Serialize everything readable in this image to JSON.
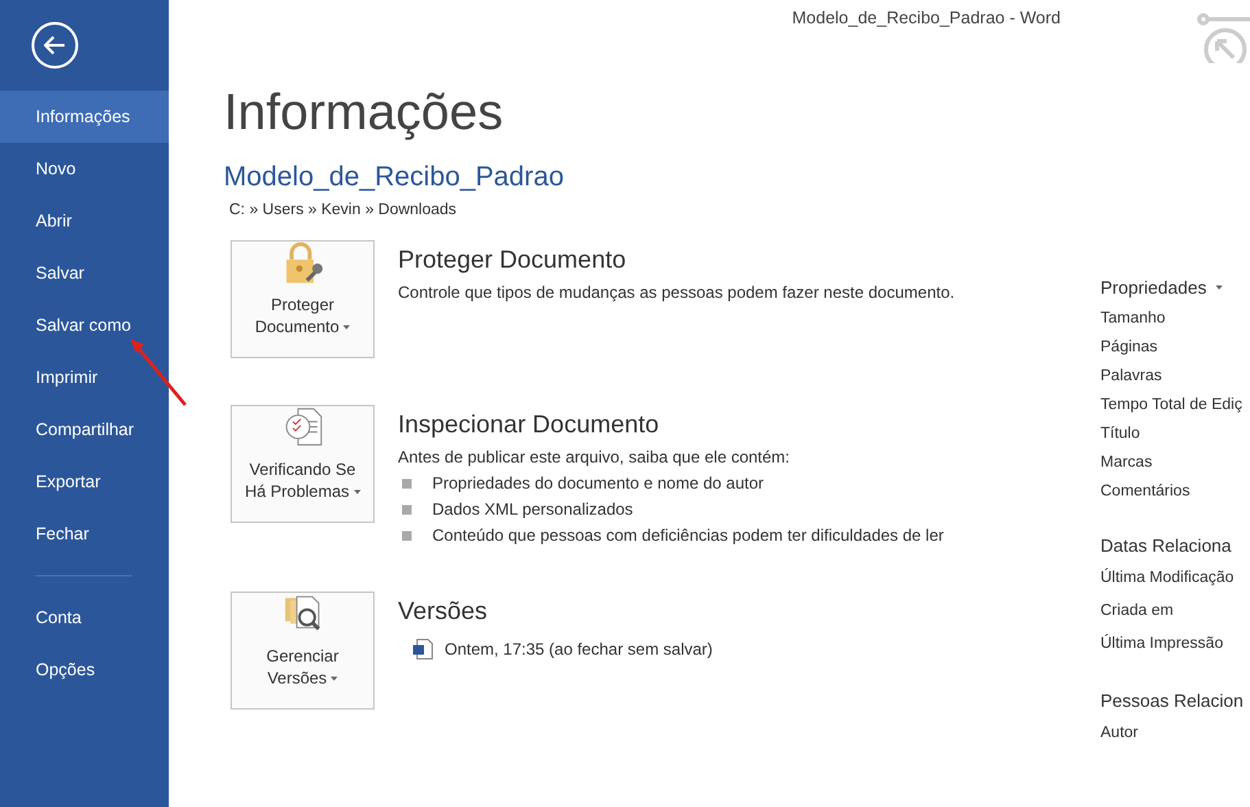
{
  "window": {
    "title": "Modelo_de_Recibo_Padrao - Word"
  },
  "nav": {
    "main": [
      {
        "label": "Informações",
        "selected": true
      },
      {
        "label": "Novo",
        "selected": false
      },
      {
        "label": "Abrir",
        "selected": false
      },
      {
        "label": "Salvar",
        "selected": false
      },
      {
        "label": "Salvar como",
        "selected": false
      },
      {
        "label": "Imprimir",
        "selected": false
      },
      {
        "label": "Compartilhar",
        "selected": false
      },
      {
        "label": "Exportar",
        "selected": false
      },
      {
        "label": "Fechar",
        "selected": false
      }
    ],
    "secondary": [
      {
        "label": "Conta",
        "selected": false
      },
      {
        "label": "Opções",
        "selected": false
      }
    ]
  },
  "page": {
    "heading": "Informações",
    "doc_name": "Modelo_de_Recibo_Padrao",
    "path": "C: » Users » Kevin » Downloads"
  },
  "sections": [
    {
      "kind": "protect",
      "button": [
        "Proteger",
        "Documento"
      ],
      "title": "Proteger Documento",
      "text": "Controle que tipos de mudanças as pessoas podem fazer neste documento."
    },
    {
      "kind": "inspect",
      "button": [
        "Verificando Se",
        "Há Problemas"
      ],
      "title": "Inspecionar Documento",
      "text": "Antes de publicar este arquivo, saiba que ele contém:",
      "bullets": [
        "Propriedades do documento e nome do autor",
        "Dados XML personalizados",
        "Conteúdo que pessoas com deficiências podem ter dificuldades de ler"
      ]
    },
    {
      "kind": "versions",
      "button": [
        "Gerenciar",
        "Versões"
      ],
      "title": "Versões",
      "version": "Ontem, 17:35 (ao fechar sem salvar)"
    }
  ],
  "properties": {
    "groups": [
      {
        "title": "Propriedades",
        "dropdown": true,
        "items": [
          "Tamanho",
          "Páginas",
          "Palavras",
          "Tempo Total de Ediç",
          "Título",
          "Marcas",
          "Comentários"
        ]
      },
      {
        "title": "Datas Relaciona",
        "items": [
          "Última Modificação",
          "Criada em",
          "Última Impressão"
        ]
      },
      {
        "title": "Pessoas Relacion",
        "items": [
          "Autor"
        ]
      }
    ]
  }
}
